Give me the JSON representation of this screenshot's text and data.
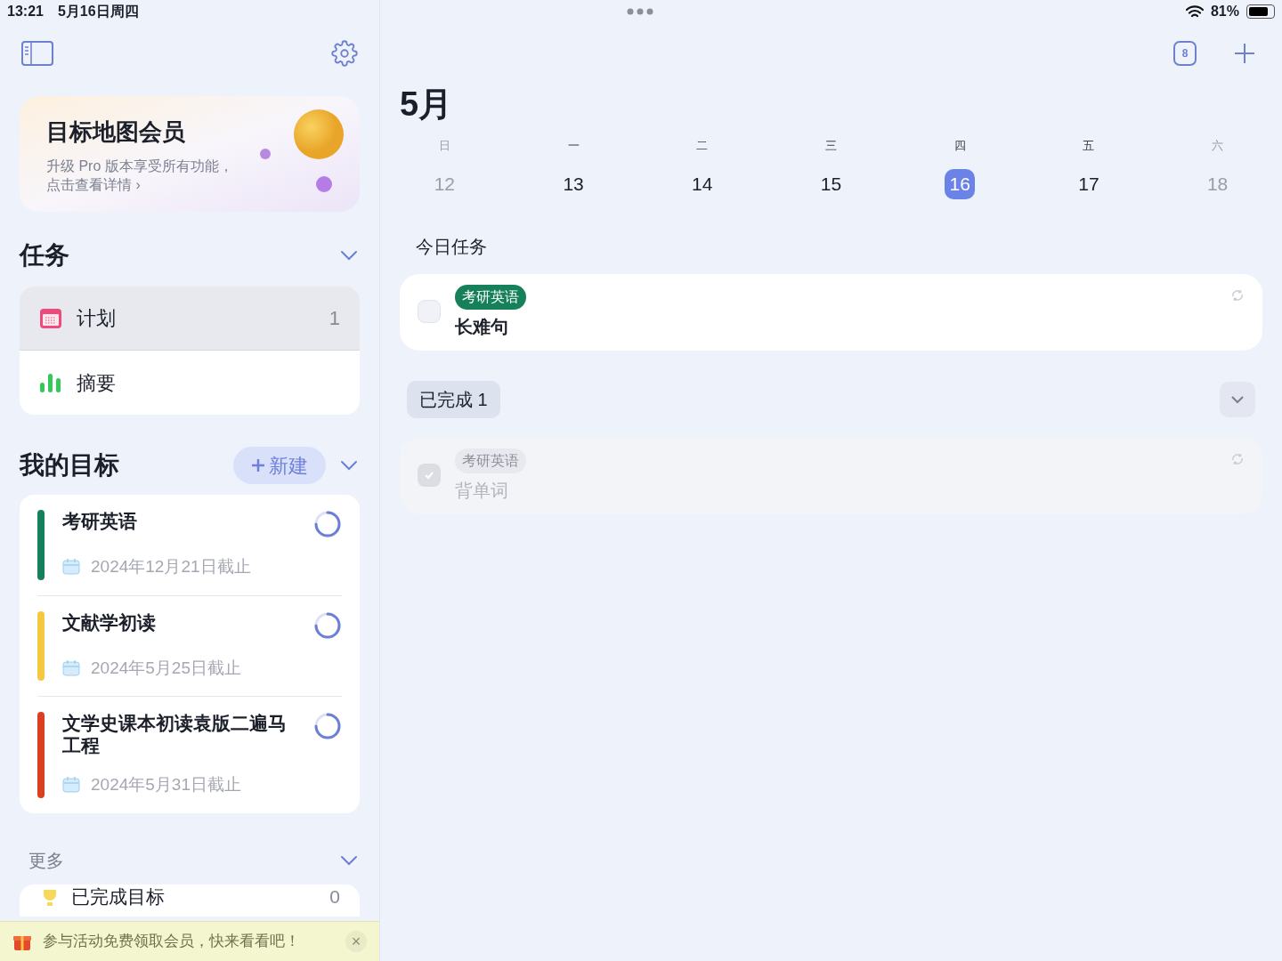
{
  "status_bar": {
    "time": "13:21",
    "date": "5月16日周四",
    "battery": "81%"
  },
  "promo": {
    "title": "目标地图会员",
    "subtitle": "升级 Pro 版本享受所有功能，",
    "link": "点击查看详情 ›"
  },
  "tasks_section": {
    "title": "任务",
    "expanded": true,
    "items": [
      {
        "kind": "calendar",
        "label": "计划",
        "count": "1",
        "selected": true
      },
      {
        "kind": "chart",
        "label": "摘要",
        "selected": false
      }
    ]
  },
  "goals_section": {
    "title": "我的目标",
    "new_button": "新建",
    "expanded": true,
    "goals": [
      {
        "title": "考研英语",
        "deadline": "2024年12月21日截止",
        "color": "#16805a"
      },
      {
        "title": "文献学初读",
        "deadline": "2024年5月25日截止",
        "color": "#f5c842"
      },
      {
        "title": "文学史课本初读袁版二遍马工程",
        "deadline": "2024年5月31日截止",
        "color": "#d9401f"
      }
    ]
  },
  "more_section": {
    "title": "更多",
    "expanded": true,
    "items": [
      {
        "label": "已完成目标",
        "count": "0"
      }
    ]
  },
  "banner": {
    "text": "参与活动免费领取会员，快来看看吧！",
    "close": "×"
  },
  "calendar": {
    "month": "5月",
    "badge": "8",
    "days": [
      {
        "weekday": "日",
        "date": "12",
        "weekend": true,
        "selected": false
      },
      {
        "weekday": "一",
        "date": "13",
        "weekend": false,
        "selected": false
      },
      {
        "weekday": "二",
        "date": "14",
        "weekend": false,
        "selected": false
      },
      {
        "weekday": "三",
        "date": "15",
        "weekend": false,
        "selected": false
      },
      {
        "weekday": "四",
        "date": "16",
        "weekend": false,
        "selected": true
      },
      {
        "weekday": "五",
        "date": "17",
        "weekend": false,
        "selected": false
      },
      {
        "weekday": "六",
        "date": "18",
        "weekend": true,
        "selected": false
      }
    ]
  },
  "today": {
    "title": "今日任务",
    "tasks": [
      {
        "tag": "考研英语",
        "title": "长难句",
        "color": "#16805a",
        "checked": false
      }
    ]
  },
  "completed": {
    "label": "已完成 1",
    "expanded": true,
    "tasks": [
      {
        "tag": "考研英语",
        "title": "背单词",
        "checked": true
      }
    ]
  }
}
